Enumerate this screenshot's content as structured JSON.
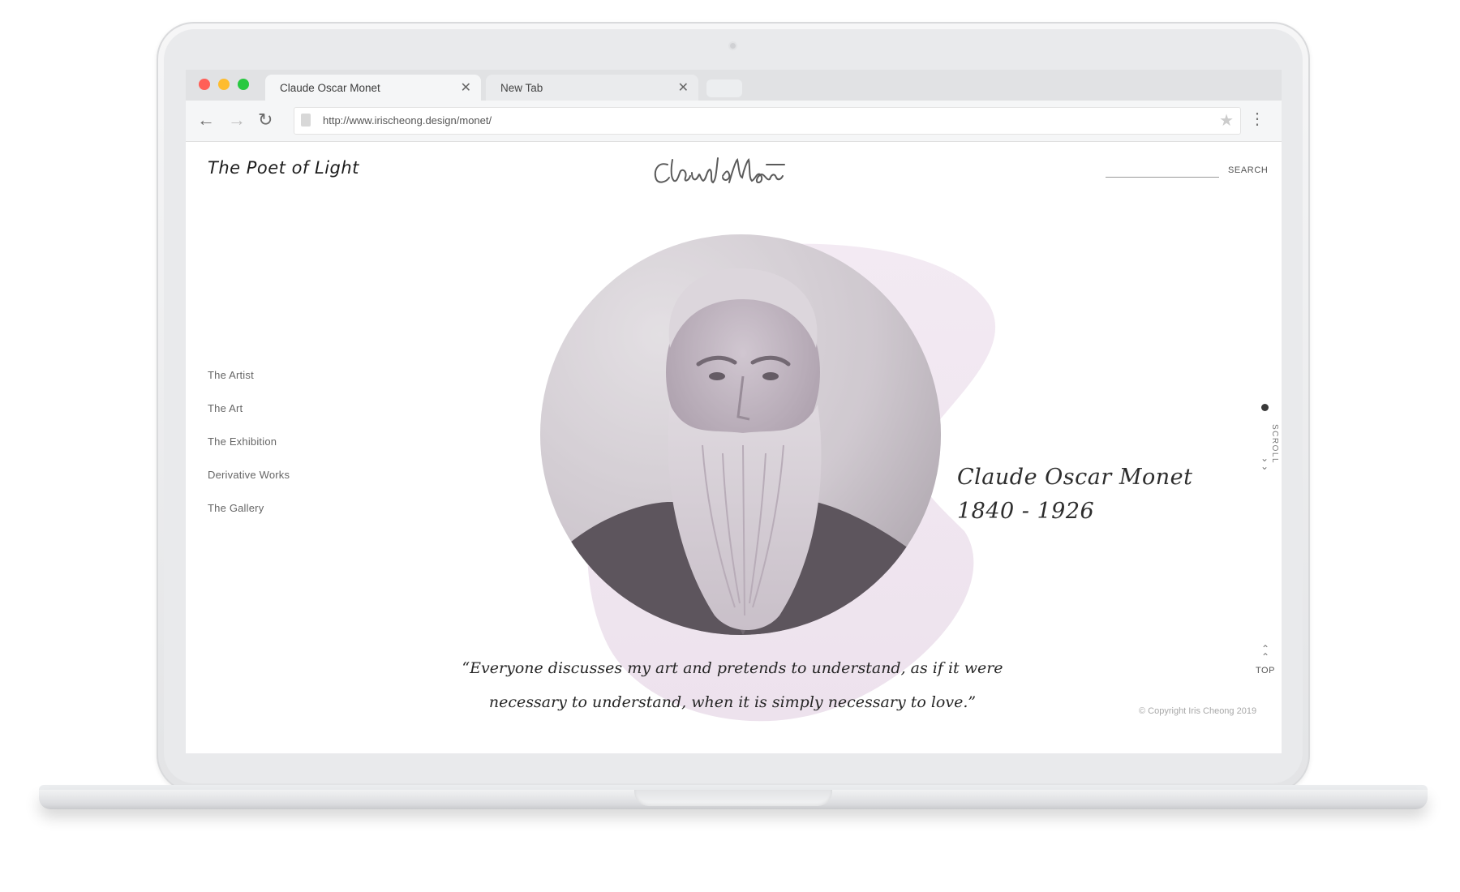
{
  "browser": {
    "tabs": [
      {
        "title": "Claude Oscar Monet",
        "active": true
      },
      {
        "title": "New Tab",
        "active": false
      }
    ],
    "url": "http://www.irischeong.design/monet/"
  },
  "header": {
    "site_title": "The Poet of Light",
    "logo_text": "Claude Monet",
    "search_label": "SEARCH"
  },
  "side_nav": [
    {
      "label": "The Artist"
    },
    {
      "label": "The Art"
    },
    {
      "label": "The Exhibition"
    },
    {
      "label": "Derivative Works"
    },
    {
      "label": "The Gallery"
    }
  ],
  "hero": {
    "name": "Claude Oscar Monet",
    "years": "1840 - 1926",
    "quote_line1": "“Everyone discusses my art and pretends to understand, as if it were",
    "quote_line2": "necessary to understand, when it is simply necessary to love.”"
  },
  "scroll_label": "SCROLL",
  "top_label": "TOP",
  "copyright": "© Copyright Iris Cheong 2019",
  "colors": {
    "accent_blob": "#efe6ef",
    "portrait_tint": "#b9aab9",
    "text": "#262626"
  }
}
